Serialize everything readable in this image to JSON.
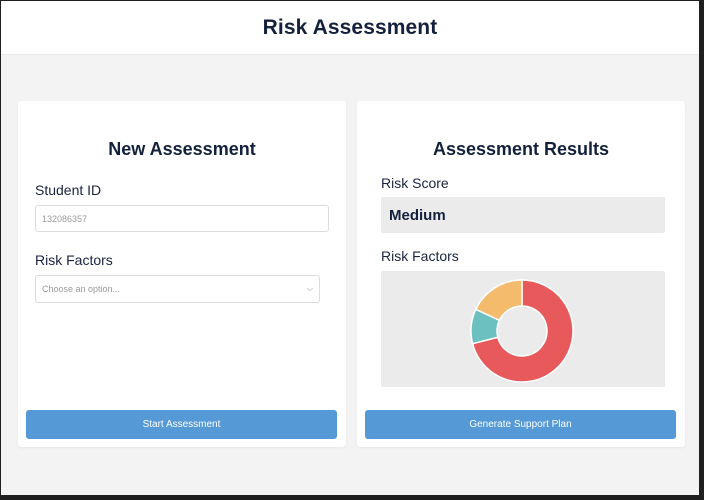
{
  "header": {
    "title": "Risk Assessment"
  },
  "new_assessment": {
    "title": "New Assessment",
    "student_id_label": "Student ID",
    "student_id_value": "132086357",
    "risk_factors_label": "Risk Factors",
    "risk_factors_placeholder": "Choose an option...",
    "start_button": "Start Assessment"
  },
  "results": {
    "title": "Assessment Results",
    "risk_score_label": "Risk Score",
    "risk_score_value": "Medium",
    "risk_factors_label": "Risk Factors",
    "generate_button": "Generate Support Plan"
  },
  "chart_data": {
    "type": "pie",
    "donut": true,
    "values": [
      0.71,
      0.11,
      0.18
    ],
    "colors": [
      "#e8595b",
      "#6cc0bf",
      "#f4bb6c"
    ]
  },
  "colors": {
    "accent": "#5599d6",
    "heading": "#14213d"
  }
}
